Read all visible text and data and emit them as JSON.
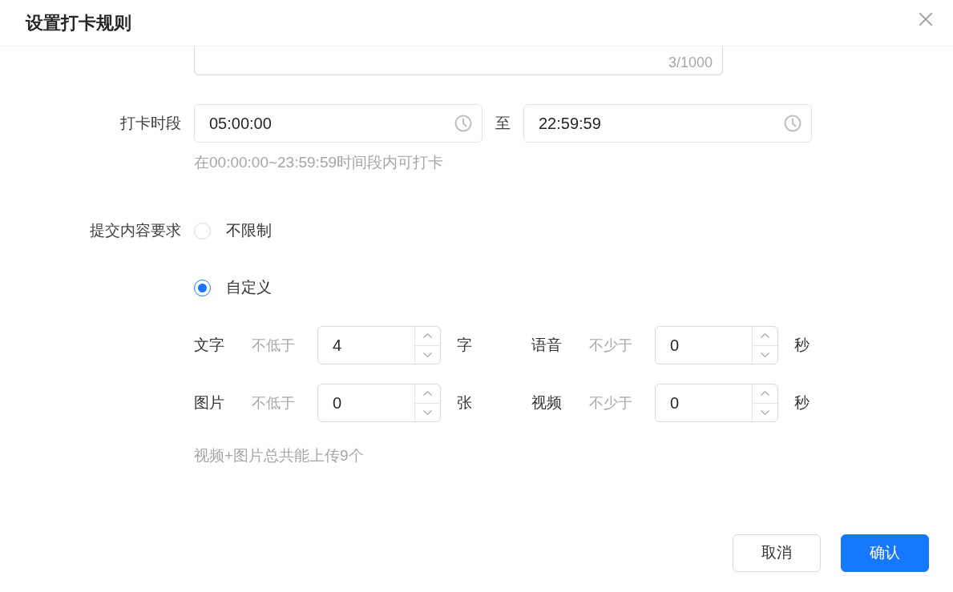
{
  "dialog": {
    "title": "设置打卡规则"
  },
  "description": {
    "counter": "3/1000"
  },
  "punch_period": {
    "label": "打卡时段",
    "start": {
      "value": "05:00:00"
    },
    "separator": "至",
    "end": {
      "value": "22:59:59"
    },
    "hint": "在00:00:00~23:59:59时间段内可打卡"
  },
  "content_requirement": {
    "label": "提交内容要求",
    "options": [
      {
        "label": "不限制",
        "selected": false
      },
      {
        "label": "自定义",
        "selected": true
      }
    ],
    "fields": [
      {
        "name": "文字",
        "qualifier": "不低于",
        "value": "4",
        "unit": "字"
      },
      {
        "name": "语音",
        "qualifier": "不少于",
        "value": "0",
        "unit": "秒"
      },
      {
        "name": "图片",
        "qualifier": "不低于",
        "value": "0",
        "unit": "张"
      },
      {
        "name": "视频",
        "qualifier": "不少于",
        "value": "0",
        "unit": "秒"
      }
    ],
    "hint": "视频+图片总共能上传9个"
  },
  "buttons": [
    {
      "label": "取消",
      "kind": "secondary"
    },
    {
      "label": "确认",
      "kind": "primary"
    }
  ]
}
